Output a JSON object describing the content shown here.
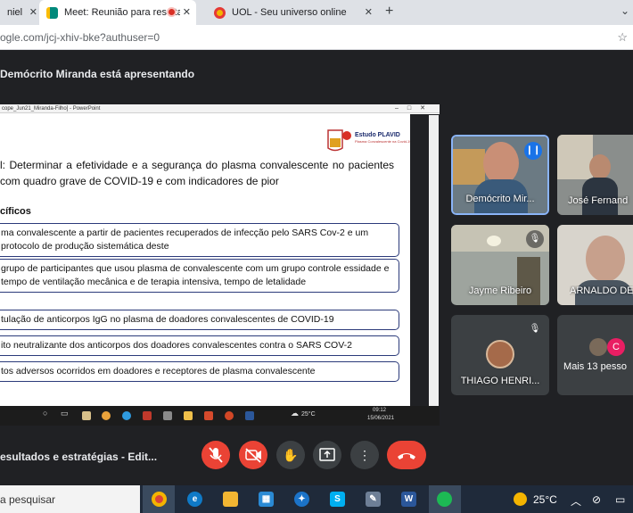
{
  "browser": {
    "tabs": [
      {
        "title": "niel",
        "favicon": "page-icon",
        "color": "#8ab4f8"
      },
      {
        "title": "Meet: Reunião para resultad",
        "favicon": "meet-icon",
        "color": "#00897b"
      },
      {
        "title": "UOL - Seu universo online",
        "favicon": "uol-icon",
        "color": "#f4b400"
      }
    ],
    "close_glyph": "✕",
    "new_tab": "+",
    "url_prefix": "ogle.com",
    "url_path": "/jcj-xhiv-bke?authuser=0"
  },
  "meet": {
    "presenter_banner": "Demócrito Miranda está apresentando",
    "shared_window_title": "cope_Jun21_Miranda-Filho] - PowerPoint",
    "slide": {
      "logo_title": "Estudo PLAVID",
      "logo_subtitle": "Plasma Convalescente na Covid-19",
      "objective": "l: Determinar a efetividade e a segurança do plasma convalescente no pacientes com quadro grave de COVID-19 e com indicadores de pior",
      "specific_heading": "cíficos",
      "items": [
        "ma convalescente a partir de pacientes recuperados de infecção pelo SARS Cov-2 e um protocolo de produção sistemática deste",
        "grupo de participantes que usou plasma de convalescente com um grupo controle essidade e tempo de ventilação mecânica e de terapia intensiva, tempo de letalidade",
        "tulação de anticorpos IgG no plasma de doadores convalescentes de COVID-19",
        "ito neutralizante dos anticorpos dos doadores convalescentes contra o SARS COV-2",
        "tos adversos ocorridos em doadores e receptores de plasma convalescente"
      ]
    },
    "inner_taskbar": {
      "temp": "25°C",
      "time": "09:12",
      "date": "15/06/2021"
    },
    "participants": [
      {
        "name": "Demócrito Mir...",
        "state": "speaking"
      },
      {
        "name": "José Fernand",
        "state": "none"
      },
      {
        "name": "Jayme Ribeiro",
        "state": "muted"
      },
      {
        "name": "ARNALDO DE",
        "state": "none"
      },
      {
        "name": "THIAGO HENRI...",
        "state": "muted"
      },
      {
        "name": "Mais 13 pesso",
        "state": "others",
        "initial": "C"
      }
    ],
    "meeting_title": "esultados e estratégias - Edit...",
    "controls": {
      "more": "⋮"
    }
  },
  "windows_taskbar": {
    "search_placeholder": "a pesquisar",
    "temperature": "25°C"
  }
}
